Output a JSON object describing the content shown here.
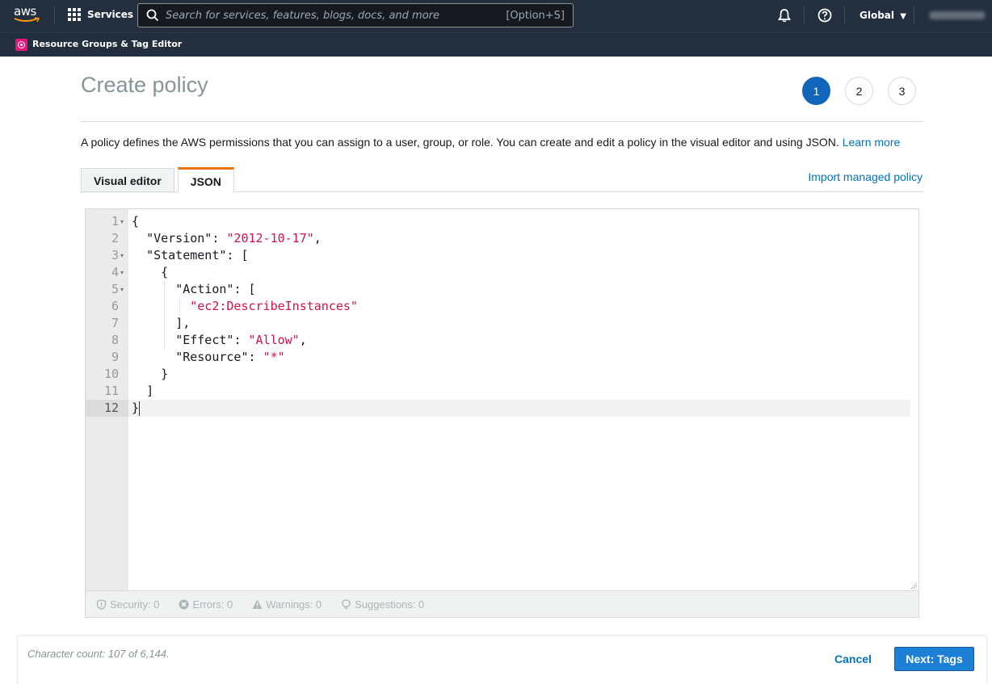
{
  "topnav": {
    "logo_text": "aws",
    "services_label": "Services",
    "search_placeholder": "Search for services, features, blogs, docs, and more",
    "search_shortcut": "[Option+S]",
    "region_label": "Global",
    "region_caret": "▼"
  },
  "subnav": {
    "service_name": "Resource Groups & Tag Editor"
  },
  "page": {
    "title": "Create policy",
    "steps": [
      "1",
      "2",
      "3"
    ],
    "active_step": 1,
    "description": "A policy defines the AWS permissions that you can assign to a user, group, or role. You can create and edit a policy in the visual editor and using JSON.",
    "learn_more": "Learn more",
    "tabs": [
      {
        "label": "Visual editor",
        "active": false
      },
      {
        "label": "JSON",
        "active": true
      }
    ],
    "import_link": "Import managed policy"
  },
  "editor": {
    "lines": [
      {
        "n": "1",
        "fold": true
      },
      {
        "n": "2",
        "fold": false
      },
      {
        "n": "3",
        "fold": true
      },
      {
        "n": "4",
        "fold": true
      },
      {
        "n": "5",
        "fold": true
      },
      {
        "n": "6",
        "fold": false
      },
      {
        "n": "7",
        "fold": false
      },
      {
        "n": "8",
        "fold": false
      },
      {
        "n": "9",
        "fold": false
      },
      {
        "n": "10",
        "fold": false
      },
      {
        "n": "11",
        "fold": false
      },
      {
        "n": "12",
        "fold": false
      }
    ],
    "tokens": {
      "l1": "{",
      "l2_key": "\"Version\"",
      "l2_sep": ": ",
      "l2_val": "\"2012-10-17\"",
      "l2_end": ",",
      "l3_key": "\"Statement\"",
      "l3_rest": ": [",
      "l4": "{",
      "l5_key": "\"Action\"",
      "l5_rest": ": [",
      "l6_val": "\"ec2:DescribeInstances\"",
      "l7": "],",
      "l8_key": "\"Effect\"",
      "l8_sep": ": ",
      "l8_val": "\"Allow\"",
      "l8_end": ",",
      "l9_key": "\"Resource\"",
      "l9_sep": ": ",
      "l9_val": "\"*\"",
      "l10": "}",
      "l11": "]",
      "l12": "}"
    },
    "active_line": 12
  },
  "validation": {
    "security": "Security: 0",
    "errors": "Errors: 0",
    "warnings": "Warnings: 0",
    "suggestions": "Suggestions: 0"
  },
  "footer": {
    "char_count": "Character count: 107 of 6,144.",
    "cancel_label": "Cancel",
    "next_label": "Next: Tags"
  },
  "colors": {
    "nav_bg": "#232f3e",
    "accent_blue": "#0073bb",
    "primary_button": "#1e7fd6",
    "active_step": "#1166bb",
    "active_tab_border": "#ec7211",
    "json_string": "#d3114b",
    "service_badge": "#e7157b"
  }
}
